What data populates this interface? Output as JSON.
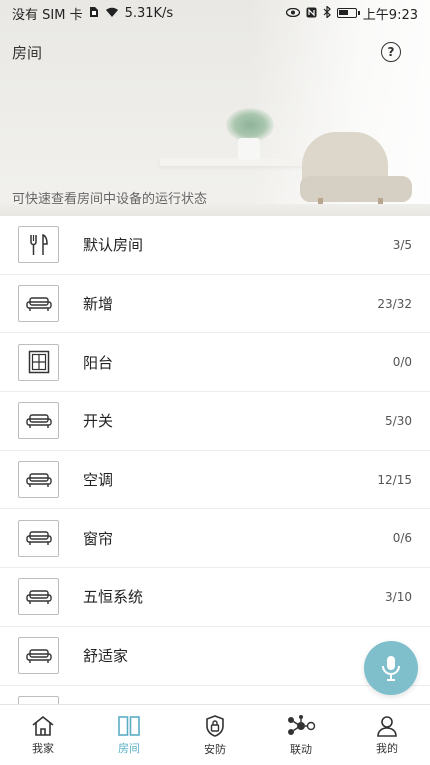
{
  "status_bar": {
    "left_text": "没有 SIM 卡",
    "speed": "5.31K/s",
    "time": "上午9:23"
  },
  "header": {
    "title": "房间",
    "subtitle": "可快速查看房间中设备的运行状态"
  },
  "rooms": [
    {
      "name": "默认房间",
      "count": "3/5",
      "icon": "utensils-icon"
    },
    {
      "name": "新增",
      "count": "23/32",
      "icon": "sofa-icon"
    },
    {
      "name": "阳台",
      "count": "0/0",
      "icon": "window-icon"
    },
    {
      "name": "开关",
      "count": "5/30",
      "icon": "sofa-icon"
    },
    {
      "name": "空调",
      "count": "12/15",
      "icon": "sofa-icon"
    },
    {
      "name": "窗帘",
      "count": "0/6",
      "icon": "sofa-icon"
    },
    {
      "name": "五恒系统",
      "count": "3/10",
      "icon": "sofa-icon"
    },
    {
      "name": "舒适家",
      "count": "",
      "icon": "sofa-icon"
    }
  ],
  "bottom_nav": [
    {
      "label": "我家",
      "icon": "home-icon",
      "active": false
    },
    {
      "label": "房间",
      "icon": "rooms-icon",
      "active": true
    },
    {
      "label": "安防",
      "icon": "security-icon",
      "active": false
    },
    {
      "label": "联动",
      "icon": "linkage-icon",
      "active": false
    },
    {
      "label": "我的",
      "icon": "user-icon",
      "active": false
    }
  ],
  "colors": {
    "accent": "#5aaec4",
    "mic_button": "#7fbfcc"
  }
}
